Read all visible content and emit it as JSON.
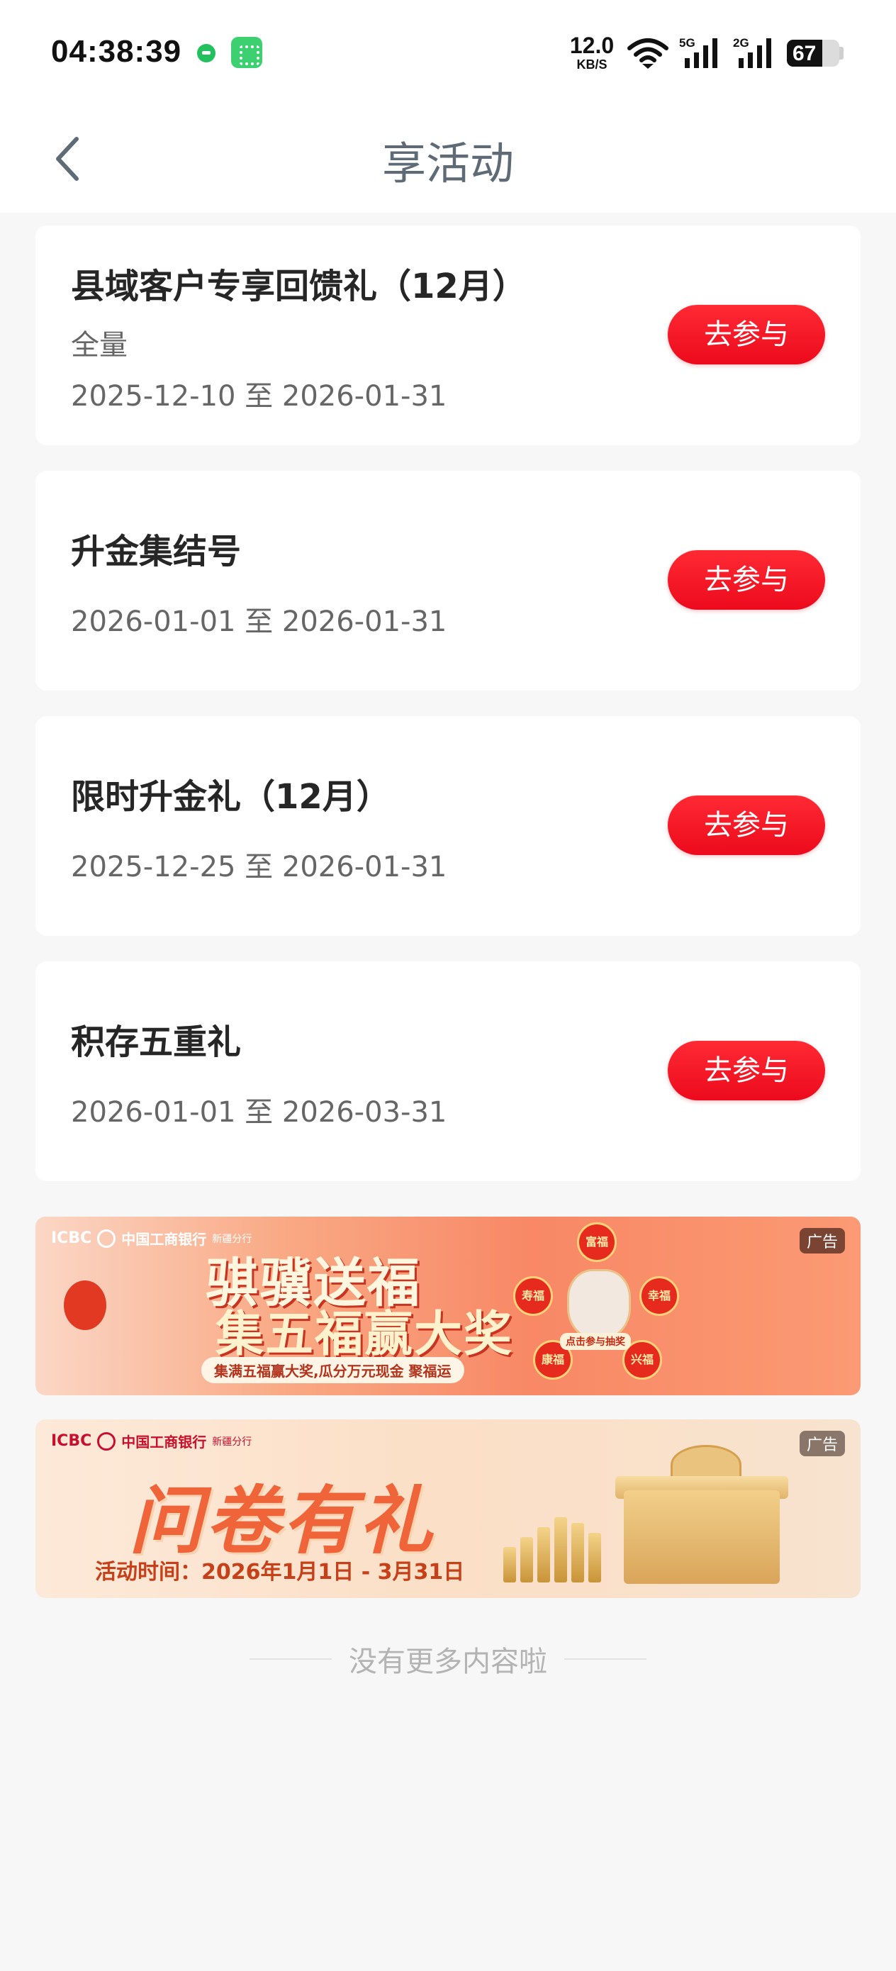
{
  "status_bar": {
    "time": "04:38:39",
    "net_speed_value": "12.0",
    "net_speed_unit": "KB/S",
    "signal_1_label": "5G",
    "signal_2_label": "2G",
    "battery_level": "67"
  },
  "nav": {
    "title": "享活动",
    "back_icon": "chevron-left-icon"
  },
  "activities": [
    {
      "title": "县域客户专享回馈礼（12月）",
      "tag": "全量",
      "date_range": "2025-12-10 至 2026-01-31",
      "button_label": "去参与"
    },
    {
      "title": "升金集结号",
      "date_range": "2026-01-01 至 2026-01-31",
      "button_label": "去参与"
    },
    {
      "title": "限时升金礼（12月）",
      "date_range": "2025-12-25 至 2026-01-31",
      "button_label": "去参与"
    },
    {
      "title": "积存五重礼",
      "date_range": "2026-01-01 至 2026-03-31",
      "button_label": "去参与"
    }
  ],
  "banners": [
    {
      "ad_label": "广告",
      "bank_brand": "ICBC",
      "bank_name": "中国工商银行",
      "bank_branch": "新疆分行",
      "title_line1": "骐骥送福",
      "title_line2": "集五福赢大奖",
      "subtitle": "集满五福赢大奖,瓜分万元现金 聚福运",
      "badges": [
        "富福",
        "寿福",
        "幸福",
        "康福",
        "兴福"
      ],
      "mascot_label": "点击参与抽奖"
    },
    {
      "ad_label": "广告",
      "bank_brand": "ICBC",
      "bank_name": "中国工商银行",
      "bank_branch": "新疆分行",
      "title": "问卷有礼",
      "date_text": "活动时间：2026年1月1日 - 3月31日"
    }
  ],
  "footer": {
    "end_text": "没有更多内容啦"
  },
  "colors": {
    "accent_red": "#ec0a1c",
    "title_gray": "#5e6b76",
    "background": "#f7f7f7"
  }
}
